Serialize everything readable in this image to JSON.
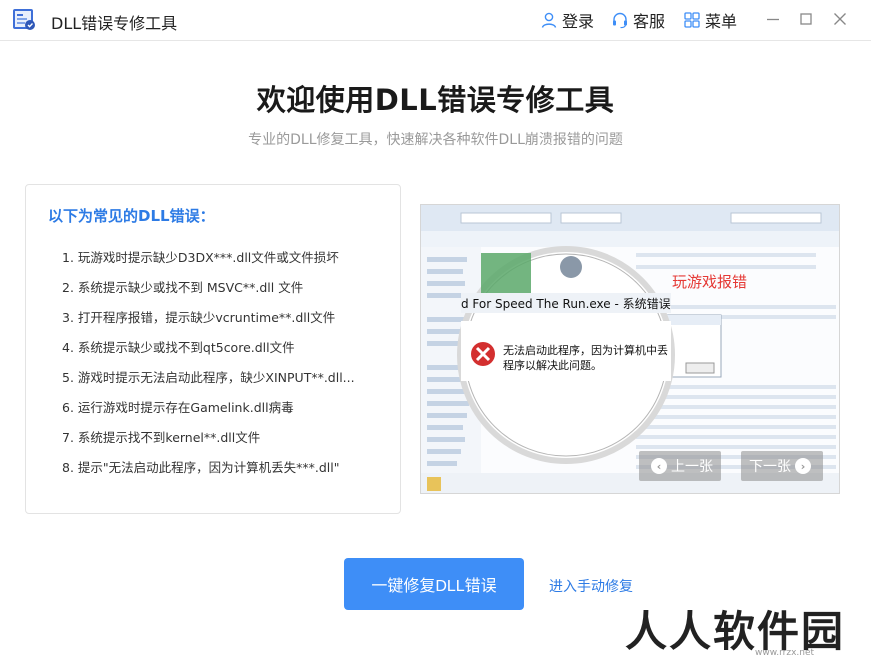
{
  "app": {
    "title": "DLL错误专修工具"
  },
  "header": {
    "login_label": "登录",
    "service_label": "客服",
    "menu_label": "菜单"
  },
  "main": {
    "heading": "欢迎使用DLL错误专修工具",
    "subheading": "专业的DLL修复工具，快速解决各种软件DLL崩溃报错的问题"
  },
  "errors_card": {
    "title": "以下为常见的DLL错误：",
    "items": [
      "1. 玩游戏时提示缺少D3DX***.dll文件或文件损坏",
      "2. 系统提示缺少或找不到 MSVC**.dll 文件",
      "3. 打开程序报错，提示缺少vcruntime**.dll文件",
      "4. 系统提示缺少或找不到qt5core.dll文件",
      "5. 游戏时提示无法启动此程序，缺少XINPUT**.dll...",
      "6. 运行游戏时提示存在Gamelink.dll病毒",
      "7. 系统提示找不到kernel**.dll文件",
      "8. 提示\"无法启动此程序，因为计算机丢失***.dll\""
    ]
  },
  "preview": {
    "caption": "玩游戏报错",
    "dialog_title": "d For Speed The Run.exe - 系统错误",
    "dialog_message_line1": "无法启动此程序，因为计算机中丢",
    "dialog_message_line2": "程序以解决此问题。",
    "prev_label": "上一张",
    "next_label": "下一张",
    "colors": {
      "caption": "#e53935",
      "error_icon": "#d32f2f"
    }
  },
  "actions": {
    "primary_label": "一键修复DLL错误",
    "manual_link": "进入手动修复"
  },
  "watermark": {
    "text": "人人软件园",
    "url_text": "www.rrzx.net"
  },
  "colors": {
    "accent": "#3e8ef7",
    "link": "#2d7be5"
  }
}
